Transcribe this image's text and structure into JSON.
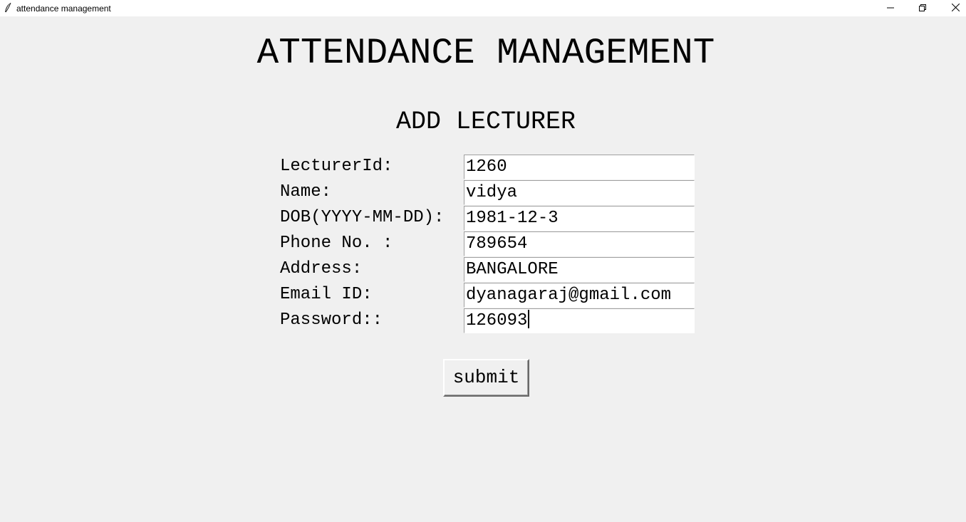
{
  "window": {
    "title": "attendance management",
    "app_icon": "feather-icon",
    "controls": [
      "minimize-icon",
      "restore-icon",
      "close-icon"
    ]
  },
  "header": {
    "title": "ATTENDANCE MANAGEMENT",
    "subtitle": "ADD LECTURER"
  },
  "form": {
    "fields": [
      {
        "label": "LecturerId:",
        "value": "1260"
      },
      {
        "label": "Name:",
        "value": "vidya"
      },
      {
        "label": "DOB(YYYY-MM-DD):",
        "value": "1981-12-3"
      },
      {
        "label": "Phone No. :",
        "value": "789654"
      },
      {
        "label": "Address:",
        "value": "BANGALORE"
      },
      {
        "label": "Email ID:",
        "value": "dyanagaraj@gmail.com"
      },
      {
        "label": "Password::",
        "value": "126093"
      }
    ],
    "submit_label": "submit",
    "focused_field": "Password::"
  }
}
